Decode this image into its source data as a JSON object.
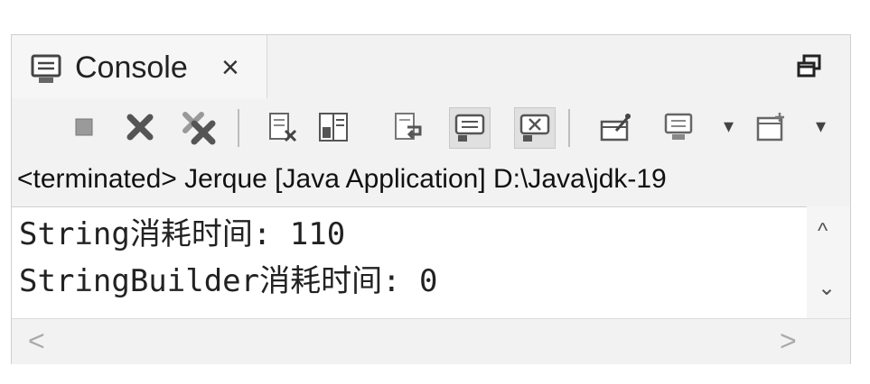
{
  "tab": {
    "label": "Console",
    "close": "×"
  },
  "status": "<terminated> Jerque [Java Application] D:\\Java\\jdk-19",
  "output": [
    "String消耗时间: 110",
    "StringBuilder消耗时间: 0"
  ],
  "scroll": {
    "up": "^",
    "down": "⌄",
    "left": "<",
    "right": ">"
  },
  "toolbar": {
    "icons": [
      "terminate-icon",
      "remove-launch-icon",
      "remove-all-terminated-icon",
      "clear-console-icon",
      "scroll-lock-icon",
      "word-wrap-icon",
      "show-on-stdout-icon",
      "show-on-stderr-icon",
      "pin-console-icon",
      "display-selected-console-icon",
      "open-console-icon"
    ],
    "dropdown": "▾"
  },
  "colors": {
    "frame": "#f2f2f2",
    "output_bg": "#ffffff",
    "text": "#222222"
  }
}
